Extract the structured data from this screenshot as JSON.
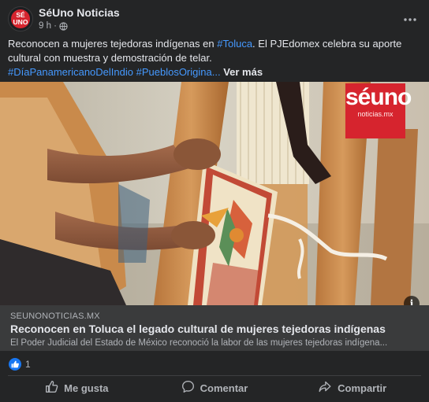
{
  "header": {
    "page_name": "SéUno Noticias",
    "time": "9 h ·",
    "avatar_text": "SÉ UNO",
    "more_icon": "more-dots-icon"
  },
  "post": {
    "text_main": "Reconocen a mujeres tejedoras indígenas en ",
    "hashtag_toluca": "#Toluca",
    "text_rest": ". El PJEdomex celebra su aporte cultural con muestra y demostración de telar.",
    "hashtag_dia": "#DíaPanamericanoDelIndio",
    "hashtag_pueblos": "#PueblosOrigina...",
    "see_more": "Ver más"
  },
  "image": {
    "logo_big": "séuno",
    "logo_small": "noticias.mx",
    "info_icon": "info-icon"
  },
  "link": {
    "domain": "SEUNONOTICIAS.MX",
    "title": "Reconocen en Toluca el legado cultural de mujeres tejedoras indígenas",
    "description": "El Poder Judicial del Estado de México reconoció la labor de las mujeres tejedoras indígena..."
  },
  "reactions": {
    "count": "1",
    "icon": "like-reaction-icon"
  },
  "actions": {
    "like": "Me gusta",
    "comment": "Comentar",
    "share": "Compartir"
  },
  "colors": {
    "background": "#242526",
    "link_box": "#3a3b3c",
    "hashtag": "#4599ff",
    "brand_red": "#d6242e",
    "like_blue": "#1877f2"
  }
}
